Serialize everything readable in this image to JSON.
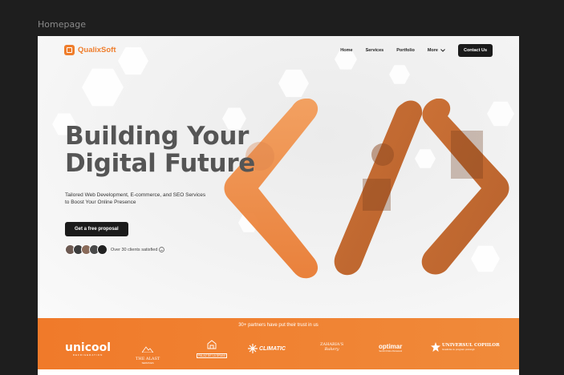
{
  "frame_label": "Homepage",
  "brand": {
    "name": "QualixSoft",
    "accent": "#ef7d2b"
  },
  "nav": {
    "items": [
      "Home",
      "Services",
      "Portfolio"
    ],
    "more": "More",
    "contact": "Contact Us"
  },
  "hero": {
    "title_line1": "Building Your",
    "title_line2": "Digital Future",
    "subtitle": "Tailored Web Development, E-commerce, and SEO Services to Boost Your Online Presence",
    "cta": "Get a free proposal",
    "social_proof": "Over 30 clients satisfied",
    "social_proof_icon": "smiley-icon"
  },
  "partners": {
    "title": "30+ partners have put their trust in us",
    "logos": [
      {
        "name": "unicool",
        "tagline": "REFRIGERATION"
      },
      {
        "name": "THE ALAST",
        "tagline": "SERVICES"
      },
      {
        "name": "PALAZ DE LA DRANI",
        "tagline": ""
      },
      {
        "name": "CLIMATIC",
        "tagline": ""
      },
      {
        "name": "ZAHARIA'S",
        "tagline": "Bakery"
      },
      {
        "name": "optimar",
        "tagline": "Servicii Online Romanesti"
      },
      {
        "name": "UNIVERSUL COPIILOR",
        "tagline": "Gradinita cu program prelungit"
      }
    ]
  }
}
